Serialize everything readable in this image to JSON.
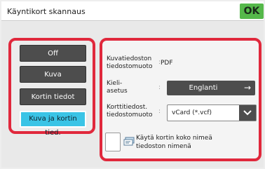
{
  "header": {
    "title": "Käyntikort skannaus",
    "ok_label": "OK"
  },
  "modes": [
    {
      "label": "Off",
      "selected": false
    },
    {
      "label": "Kuva",
      "selected": false
    },
    {
      "label": "Kortin tiedot",
      "selected": false
    },
    {
      "label": "Kuva ja kortin tied.",
      "selected": true
    }
  ],
  "settings": {
    "image_format_label": "Kuvatiedoston tiedostomuoto",
    "image_format_label_line1": "Kuvatiedoston",
    "image_format_label_line2": "tiedostomuoto",
    "image_format_value": "PDF",
    "language_label_line1": "Kieli-",
    "language_label_line2": "asetus",
    "language_value": "Englanti",
    "card_format_label_line1": "Korttitiedost.",
    "card_format_label_line2": "tiedostomuoto",
    "card_format_value": "vCard (*.vcf)",
    "use_name_line1": "Käytä kortin koko nimeä",
    "use_name_line2": "tiedoston nimenä",
    "use_name_checked": false
  },
  "colors": {
    "highlight_border": "#e0283c",
    "ok_button": "#55b84a",
    "selected_mode": "#3ac4e6",
    "button_dark": "#4d4d4d"
  }
}
